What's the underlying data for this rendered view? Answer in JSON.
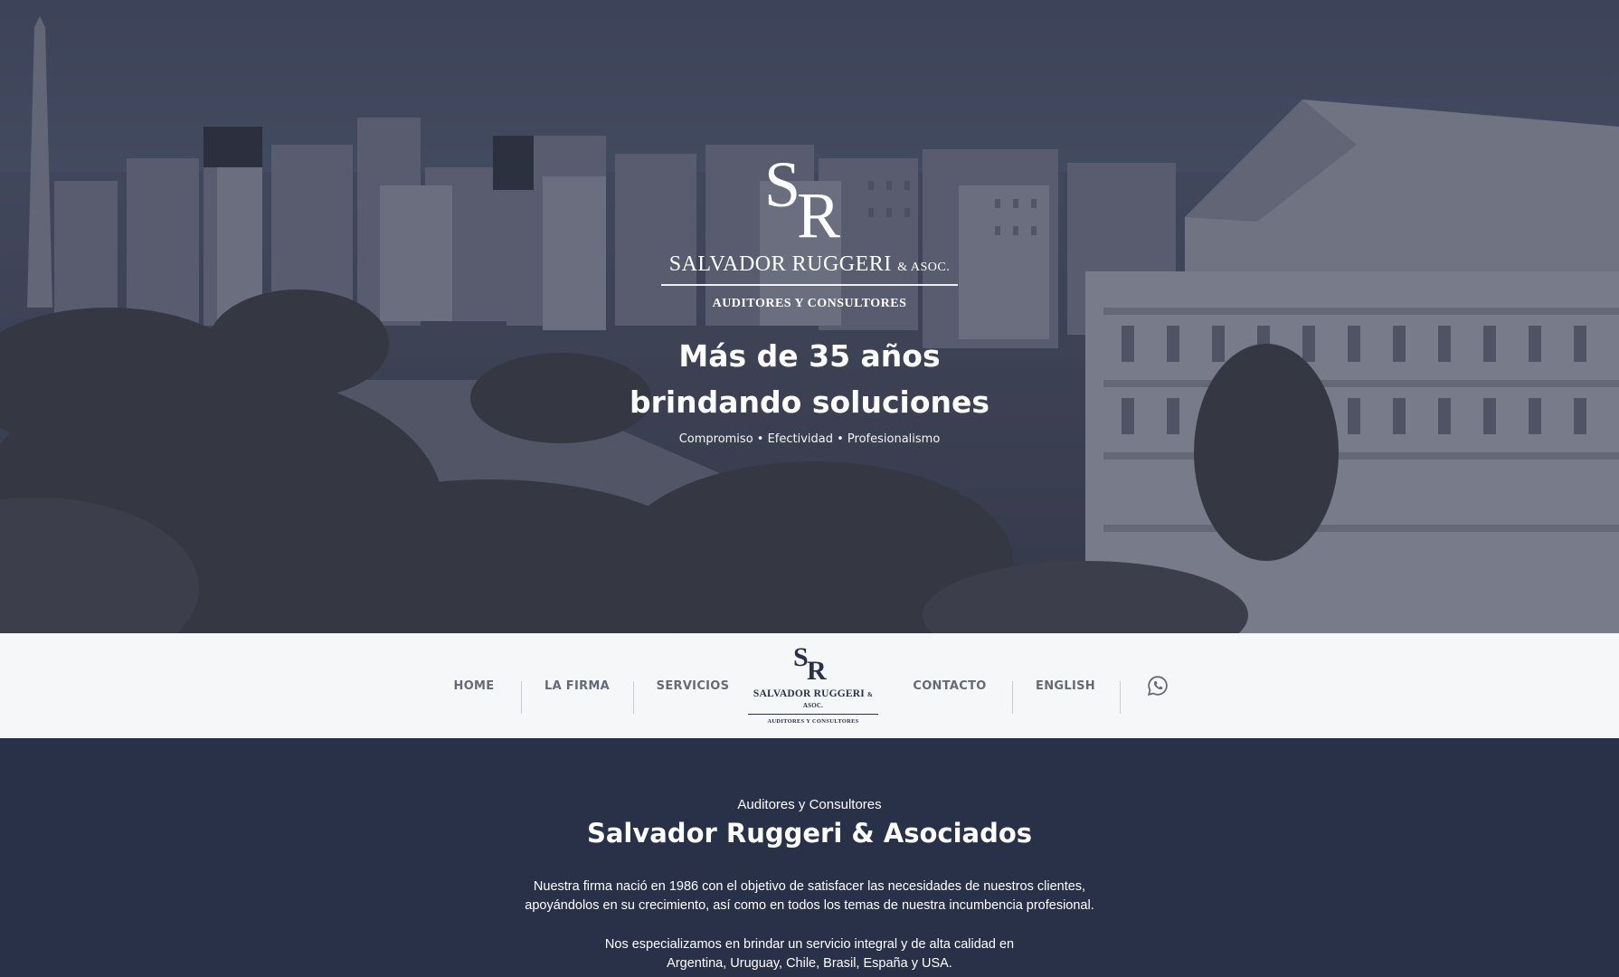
{
  "hero": {
    "logo_monogram": "SR",
    "firm_name": "SALVADOR RUGGERI",
    "firm_suffix": "& ASOC.",
    "firm_subtitle": "AUDITORES Y CONSULTORES",
    "title_line1": "Más de 35 años",
    "title_line2": "brindando soluciones",
    "tagline": "Compromiso • Efectividad • Profesionalismo"
  },
  "nav": {
    "items": [
      {
        "label": "HOME"
      },
      {
        "label": "LA FIRMA"
      },
      {
        "label": "SERVICIOS"
      },
      {
        "label": "CONTACTO"
      },
      {
        "label": "ENGLISH"
      }
    ],
    "logo": {
      "monogram": "SR",
      "name": "SALVADOR RUGGERI",
      "suffix": "& ASOC.",
      "subtitle": "AUDITORES Y CONSULTORES"
    },
    "social_icon": "whatsapp-icon"
  },
  "about": {
    "kicker": "Auditores y Consultores",
    "heading": "Salvador Ruggeri & Asociados",
    "paragraph1_line1": "Nuestra firma nació en 1986 con el objetivo de satisfacer las necesidades de nuestros clientes,",
    "paragraph1_line2": "apoyándolos en su crecimiento, así como en todos los temas de nuestra incumbencia profesional.",
    "paragraph2_line1": "Nos especializamos en brindar un servicio integral y de alta calidad en",
    "paragraph2_line2": "Argentina, Uruguay, Chile, Brasil, España y USA."
  },
  "colors": {
    "brand_navy": "#293149",
    "nav_background": "#f6f7f9",
    "nav_text": "#666a73"
  }
}
